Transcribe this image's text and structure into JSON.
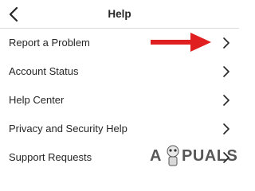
{
  "header": {
    "title": "Help",
    "back_icon": "chevron-left-icon"
  },
  "menu": {
    "items": [
      {
        "label": "Report a Problem",
        "icon": "chevron-right-icon"
      },
      {
        "label": "Account Status",
        "icon": "chevron-right-icon"
      },
      {
        "label": "Help Center",
        "icon": "chevron-right-icon"
      },
      {
        "label": "Privacy and Security Help",
        "icon": "chevron-right-icon"
      },
      {
        "label": "Support Requests",
        "icon": "chevron-right-icon"
      }
    ]
  },
  "annotation": {
    "type": "arrow",
    "color": "#e02020",
    "points_to": "Report a Problem"
  },
  "watermark": {
    "text_a": "A",
    "text_rest": "PUALS"
  },
  "colors": {
    "text": "#262626",
    "divider": "#dbdbdb",
    "arrow": "#e02020"
  }
}
